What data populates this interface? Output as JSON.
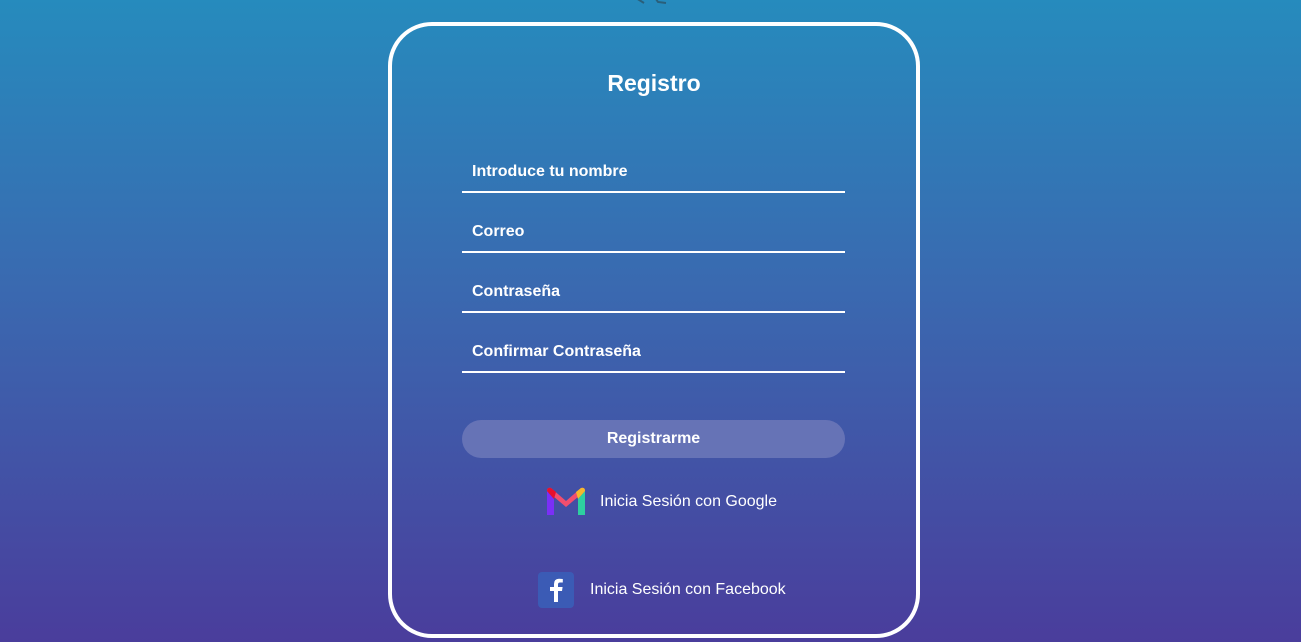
{
  "form": {
    "title": "Registro",
    "fields": [
      {
        "placeholder": "Introduce tu nombre",
        "value": ""
      },
      {
        "placeholder": "Correo",
        "value": ""
      },
      {
        "placeholder": "Contraseña",
        "value": ""
      },
      {
        "placeholder": "Confirmar Contraseña",
        "value": ""
      }
    ],
    "submit_label": "Registrarme"
  },
  "social": {
    "google_label": "Inicia Sesión con Google",
    "google_icon": "gmail-icon",
    "facebook_label": "Inicia Sesión con Facebook",
    "facebook_icon": "facebook-icon"
  },
  "colors": {
    "background_top": "#268bbd",
    "background_bottom": "#4a3d9c",
    "card_border": "#ffffff",
    "button_bg": "#6673b6",
    "facebook_blue": "#3b5bb5"
  }
}
